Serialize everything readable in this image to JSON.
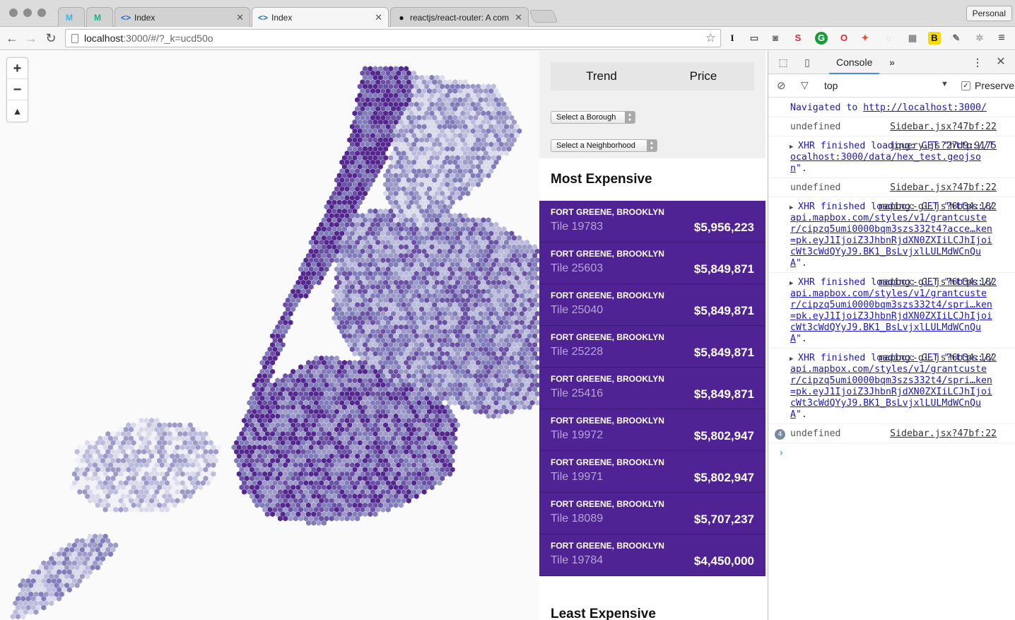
{
  "browser": {
    "tabs": [
      {
        "label": "",
        "icon": "M"
      },
      {
        "label": "",
        "icon": "M"
      },
      {
        "label": "Index",
        "icon": "code-icon"
      },
      {
        "label": "Index",
        "icon": "code-icon"
      },
      {
        "label": "reactjs/react-router: A com",
        "icon": "github-icon"
      }
    ],
    "profile_label": "Personal",
    "url_host": "localhost",
    "url_rest": ":3000/#/?_k=ucd50o"
  },
  "sidebar": {
    "tabs": [
      "Trend",
      "Price"
    ],
    "borough_select": "Select a Borough",
    "neighborhood_select": "Select a Neighborhood",
    "most_expensive_title": "Most Expensive",
    "least_expensive_title": "Least Expensive",
    "most_expensive": [
      {
        "neighborhood": "FORT GREENE, BROOKLYN",
        "tile": "Tile 19783",
        "price": "$5,956,223"
      },
      {
        "neighborhood": "FORT GREENE, BROOKLYN",
        "tile": "Tile 25603",
        "price": "$5,849,871"
      },
      {
        "neighborhood": "FORT GREENE, BROOKLYN",
        "tile": "Tile 25040",
        "price": "$5,849,871"
      },
      {
        "neighborhood": "FORT GREENE, BROOKLYN",
        "tile": "Tile 25228",
        "price": "$5,849,871"
      },
      {
        "neighborhood": "FORT GREENE, BROOKLYN",
        "tile": "Tile 25416",
        "price": "$5,849,871"
      },
      {
        "neighborhood": "FORT GREENE, BROOKLYN",
        "tile": "Tile 19972",
        "price": "$5,802,947"
      },
      {
        "neighborhood": "FORT GREENE, BROOKLYN",
        "tile": "Tile 19971",
        "price": "$5,802,947"
      },
      {
        "neighborhood": "FORT GREENE, BROOKLYN",
        "tile": "Tile 18089",
        "price": "$5,707,237"
      },
      {
        "neighborhood": "FORT GREENE, BROOKLYN",
        "tile": "Tile 19784",
        "price": "$4,450,000"
      }
    ]
  },
  "devtools": {
    "tab": "Console",
    "context": "top",
    "preserve_label": "Preserve",
    "messages": {
      "m1_text": "Navigated to ",
      "m1_link": "http://localhost:3000/",
      "m2_text": "undefined",
      "m2_src": "Sidebar.jsx?47bf:22",
      "m3_src": "jquery.js?27d9:9175",
      "m3_text": "XHR finished loading: GET \"",
      "m3_link": "http://localhost:3000/data/hex_test.geojson",
      "m3_end": "\".",
      "m4_text": "undefined",
      "m4_src": "Sidebar.jsx?47bf:22",
      "m5_src": "mapbox-gl.js?6b34:182",
      "m5_text": "XHR finished loading: GET \"",
      "m5_link": "https://api.mapbox.com/styles/v1/grantcuster/cipzq5umi0000bqm3szs332t4?acce…ken=pk.eyJ1IjoiZ3JhbnRjdXN0ZXIiLCJhIjoicWt3cWdQYyJ9.BK1_BsLvjxlLULMdWCnQuA",
      "m5_end": "\".",
      "m6_src": "mapbox-gl.js?6b34:182",
      "m6_text": "XHR finished loading: GET \"",
      "m6_link": "https://api.mapbox.com/styles/v1/grantcuster/cipzq5umi0000bqm3szs332t4/spri…ken=pk.eyJ1IjoiZ3JhbnRjdXN0ZXIiLCJhIjoicWt3cWdQYyJ9.BK1_BsLvjxlLULMdWCnQuA",
      "m6_end": "\".",
      "m7_src": "mapbox-gl.js?6b34:182",
      "m7_text": "XHR finished loading: GET \"",
      "m7_link": "https://api.mapbox.com/styles/v1/grantcuster/cipzq5umi0000bqm3szs332t4/spri…ken=pk.eyJ1IjoiZ3JhbnRjdXN0ZXIiLCJhIjoicWt3cWdQYyJ9.BK1_BsLvjxlLULMdWCnQuA",
      "m7_end": "\".",
      "m8_count": "4",
      "m8_text": "undefined",
      "m8_src": "Sidebar.jsx?47bf:22"
    }
  },
  "colors": {
    "accent_purple": "#4f2393",
    "hex_dark": "#54278f",
    "hex_light": "#dadaeb"
  }
}
